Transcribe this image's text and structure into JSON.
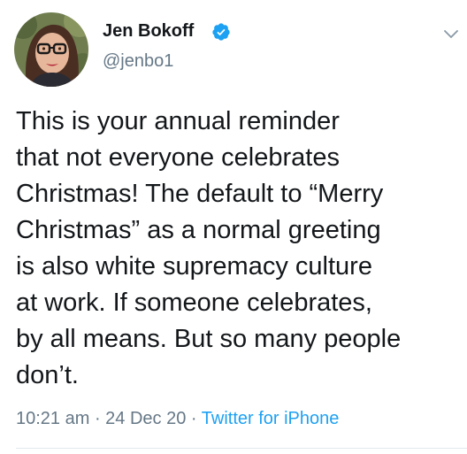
{
  "author": {
    "name": "Jen Bokoff",
    "handle": "@jenbo1",
    "verified": true
  },
  "icons": {
    "verified": "verified-badge-icon",
    "more": "chevron-down-icon",
    "avatar": "profile-photo"
  },
  "tweet": {
    "text": "This is your annual reminder\nthat not everyone celebrates\nChristmas! The default to “Merry\nChristmas” as a normal greeting\nis also white supremacy culture\nat work. If someone celebrates,\nby all means. But so many people\ndon’t."
  },
  "meta": {
    "time": "10:21 am",
    "separator": " · ",
    "date": "24 Dec 20",
    "source": "Twitter for iPhone"
  },
  "colors": {
    "text": "#14171a",
    "secondary": "#657786",
    "accent": "#1da1f2",
    "divider": "#e1e8ed"
  }
}
